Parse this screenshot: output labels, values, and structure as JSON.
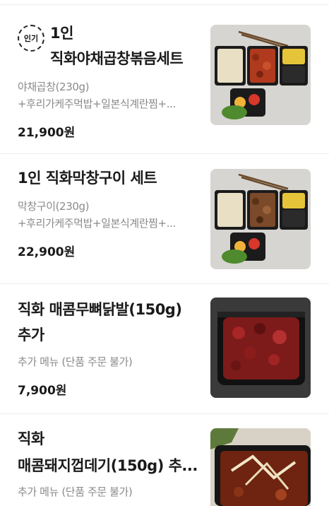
{
  "items": [
    {
      "badge": "인기",
      "title": "1인 직화야채곱창볶음세트",
      "desc_line1": "야채곱창(230g)",
      "desc_line2": "+후리가케주먹밥+일본식계란찜+...",
      "price": "21,900원"
    },
    {
      "title": "1인 직화막창구이 세트",
      "desc_line1": "막창구이(230g)",
      "desc_line2": "+후리가케주먹밥+일본식계란찜+...",
      "price": "22,900원"
    },
    {
      "title": "직화 매콤무뼈닭발(150g) 추가",
      "desc_line1": "추가 메뉴 (단품 주문 불가)",
      "price": "7,900원"
    },
    {
      "title_line1": "직화",
      "title_line2": "매콤돼지껍데기(150g) 추...",
      "desc_line1": "추가 메뉴 (단품 주문 불가)"
    }
  ]
}
